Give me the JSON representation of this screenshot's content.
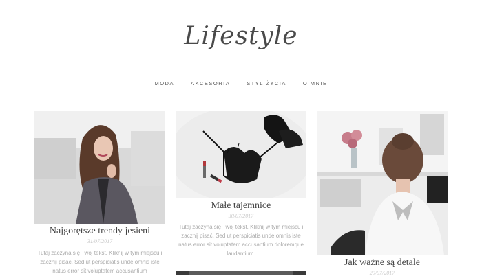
{
  "site": {
    "logo": "Lifestyle"
  },
  "nav": {
    "items": [
      {
        "label": "MODA"
      },
      {
        "label": "AKCESORIA"
      },
      {
        "label": "STYL ŻYCIA"
      },
      {
        "label": "O MNIE"
      }
    ]
  },
  "posts": [
    {
      "title": "Najgorętsze trendy jesieni",
      "date": "31/07/2017",
      "excerpt": "Tutaj zaczyna się Twój tekst. Kliknij w tym miejscu i zacznij pisać. Sed ut perspiciatis unde omnis iste natus error sit voluptatem accusantium"
    },
    {
      "title": "Małe tajemnice",
      "date": "30/07/2017",
      "excerpt": "Tutaj zaczyna się Twój tekst. Kliknij w tym miejscu i zacznij pisać. Sed ut perspiciatis unde omnis iste natus error sit voluptatem accusantium doloremque laudantium."
    },
    {
      "title": "Jak ważne są detale",
      "date": "29/07/2017",
      "excerpt": ""
    }
  ]
}
